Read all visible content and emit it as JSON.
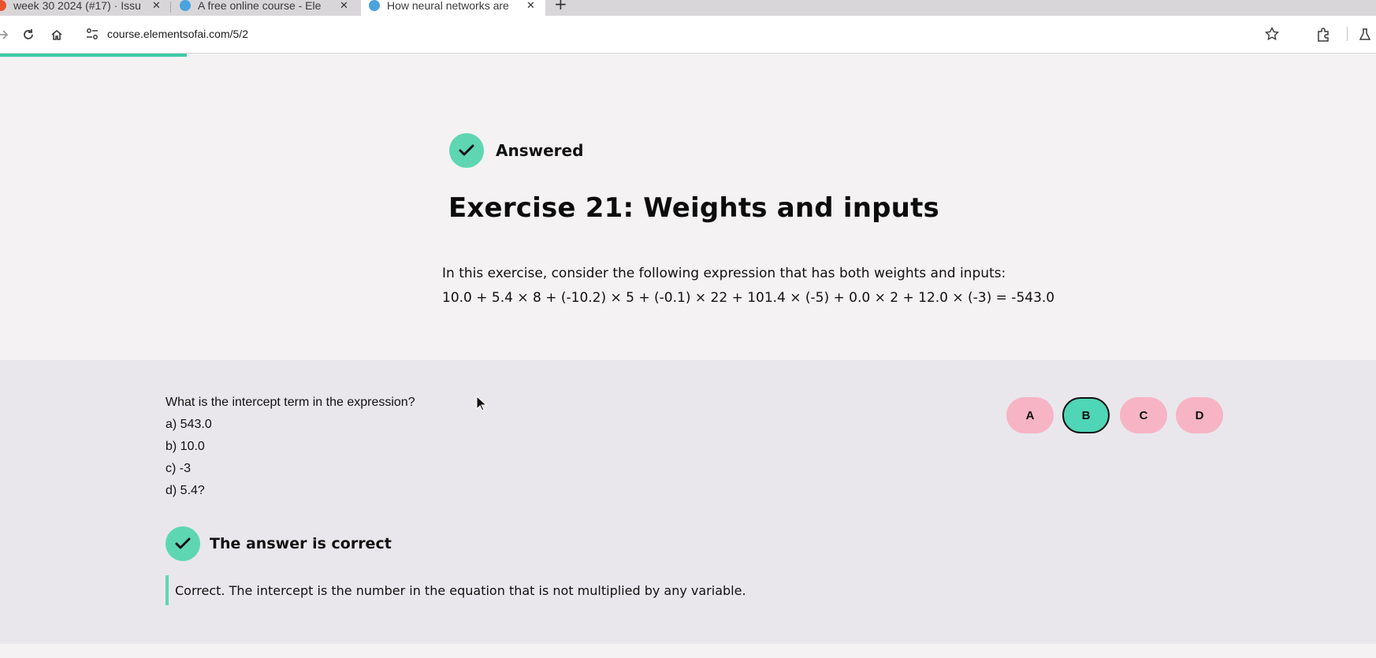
{
  "browser": {
    "tabs": [
      {
        "title": "week 30 2024 (#17) · Issu",
        "active": false
      },
      {
        "title": "A free online course - Ele",
        "active": false
      },
      {
        "title": "How neural networks are",
        "active": true
      }
    ],
    "url": "course.elementsofai.com/5/2"
  },
  "exercise": {
    "status": "Answered",
    "title": "Exercise 21: Weights and inputs",
    "intro": "In this exercise, consider the following expression that has both weights and inputs:",
    "expression": "10.0 + 5.4 × 8 + (-10.2) × 5 + (-0.1) × 22 + 101.4 × (-5) + 0.0 × 2 + 12.0 × (-3) = -543.0"
  },
  "question": {
    "text": "What is the intercept term in the expression?",
    "options": [
      "a) 543.0",
      "b) 10.0",
      "c) -3",
      "d) 5.4?"
    ],
    "answer_buttons": [
      "A",
      "B",
      "C",
      "D"
    ],
    "selected": "B",
    "result": "The answer is correct",
    "feedback": "Correct. The intercept is the number in the equation that is not multiplied by any variable."
  },
  "colors": {
    "accent_green": "#5ed6b2",
    "answer_pink": "#f6b4c4",
    "panel_bg": "#e9e7ec",
    "page_bg": "#f4f2f2"
  }
}
